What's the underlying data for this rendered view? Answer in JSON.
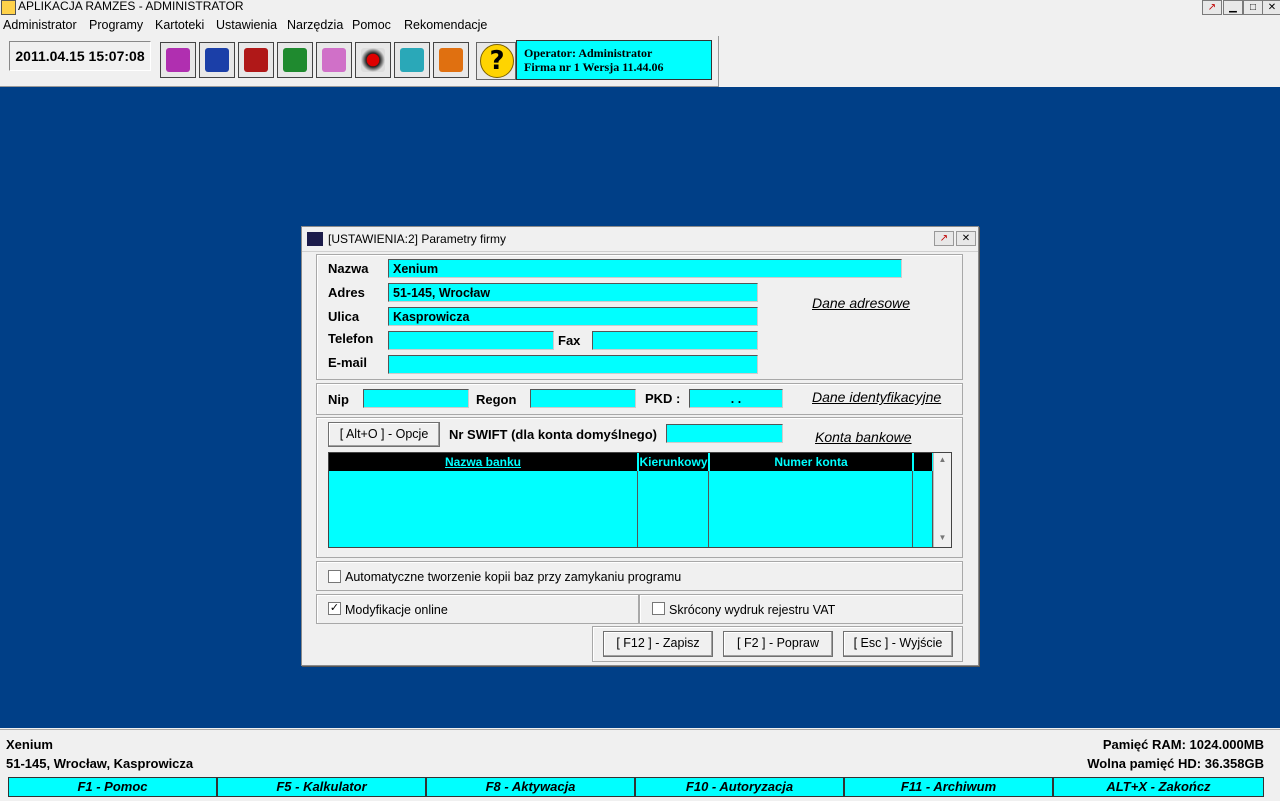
{
  "window": {
    "title": "APLIKACJA RAMZES - ADMINISTRATOR"
  },
  "menu": [
    "Administrator",
    "Programy",
    "Kartoteki",
    "Ustawienia",
    "Narzędzia",
    "Pomoc",
    "Rekomendacje"
  ],
  "toolbar": {
    "datetime": "2011.04.15 15:07:08",
    "help_glyph": "?",
    "icons": [
      "book-icon",
      "transfer-arrows-icon",
      "mail-icon",
      "ledger-icon",
      "buildings-icon",
      "record-icon",
      "users-icon",
      "gears-icon"
    ],
    "operator_line": "Operator: Administrator",
    "firm_line": "Firma nr 1   Wersja 11.44.06"
  },
  "dialog": {
    "title": "[USTAWIENIA:2]  Parametry firmy",
    "labels": {
      "nazwa": "Nazwa",
      "adres": "Adres",
      "ulica": "Ulica",
      "telefon": "Telefon",
      "fax": "Fax",
      "email": "E-mail",
      "nip": "Nip",
      "regon": "Regon",
      "pkd": "PKD :",
      "swift": "Nr SWIFT (dla konta domyślnego)"
    },
    "values": {
      "nazwa": "Xenium",
      "adres": "51-145, Wrocław",
      "ulica": "Kasprowicza",
      "telefon": "",
      "fax": "",
      "email": "",
      "nip": "",
      "regon": "",
      "pkd": ". .",
      "swift": ""
    },
    "links": {
      "dane_adresowe": "Dane adresowe",
      "dane_identyfikacyjne": "Dane identyfikacyjne",
      "konta_bankowe": "Konta bankowe"
    },
    "opcje_button": "[ Alt+O ] - Opcje",
    "grid_headers": [
      "Nazwa banku",
      "Kierunkowy",
      "Numer konta"
    ],
    "checkboxes": {
      "auto_backup": {
        "label": "Automatyczne tworzenie kopii baz przy zamykaniu programu",
        "checked": false
      },
      "modyfikacje_online": {
        "label": "Modyfikacje online",
        "checked": true
      },
      "skrocony_wydruk": {
        "label": "Skrócony wydruk rejestru VAT",
        "checked": false
      }
    },
    "buttons": {
      "zapisz": "[ F12 ] - Zapisz",
      "popraw": "[ F2 ] - Popraw",
      "wyjscie": "[ Esc ] - Wyjście"
    }
  },
  "status": {
    "company_name": "Xenium",
    "company_address": "51-145, Wrocław, Kasprowicza",
    "ram": "Pamięć RAM: 1024.000MB",
    "hd": "Wolna pamięć HD: 36.358GB",
    "function_keys": [
      "F1 - Pomoc",
      "F5 - Kalkulator",
      "F8 - Aktywacja",
      "F10 - Autoryzacja",
      "F11 - Archiwum",
      "ALT+X - Zakończ"
    ]
  },
  "colors": {
    "desktop": "#003f87",
    "field": "#00ffff",
    "panel": "#f0f0f0"
  }
}
